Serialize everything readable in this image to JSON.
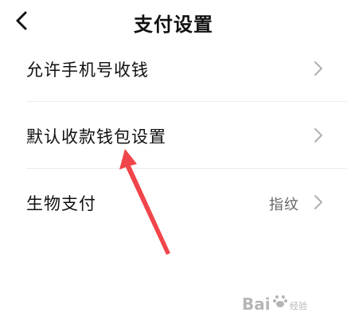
{
  "header": {
    "title": "支付设置",
    "back_icon": "chevron-left-icon"
  },
  "settings": [
    {
      "label": "允许手机号收钱",
      "value": "",
      "icon": "chevron-right-icon"
    },
    {
      "label": "默认收款钱包设置",
      "value": "",
      "icon": "chevron-right-icon"
    },
    {
      "label": "生物支付",
      "value": "指纹",
      "icon": "chevron-right-icon"
    }
  ],
  "annotation": {
    "type": "red-arrow",
    "color": "#f0454a",
    "points_to": "默认收款钱包设置"
  },
  "watermark": {
    "text": "Bai",
    "sub": "经验"
  },
  "colors": {
    "background": "#ffffff",
    "text": "#111111",
    "secondary_text": "#666666",
    "chevron": "#b0b0b0",
    "divider": "#ececec"
  }
}
